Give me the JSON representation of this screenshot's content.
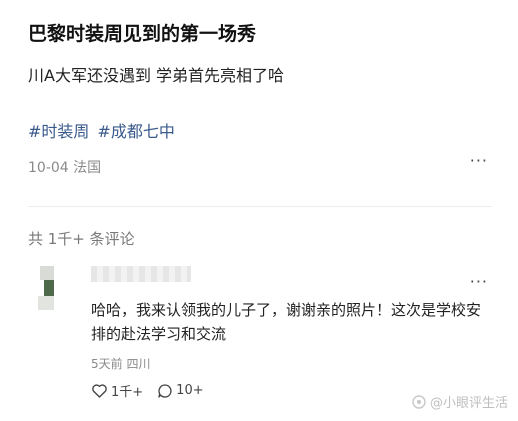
{
  "post": {
    "title": "巴黎时装周见到的第一场秀",
    "body": "川A大军还没遇到 学弟首先亮相了哈",
    "tags": [
      "#时装周",
      "#成都七中"
    ],
    "meta": "10-04 法国",
    "more_icon": "more-horizontal-icon"
  },
  "comments_section": {
    "count_label": "共 1千+ 条评论"
  },
  "comment": {
    "text": "哈哈，我来认领我的儿子了，谢谢亲的照片！这次是学校安排的赴法学习和交流",
    "meta": "5天前 四川",
    "like_count": "1千+",
    "reply_count": "10+",
    "like_icon": "heart-icon",
    "reply_icon": "comment-bubble-icon"
  },
  "watermark": {
    "text": "@小眼评生活",
    "icon": "platform-logo-icon"
  }
}
